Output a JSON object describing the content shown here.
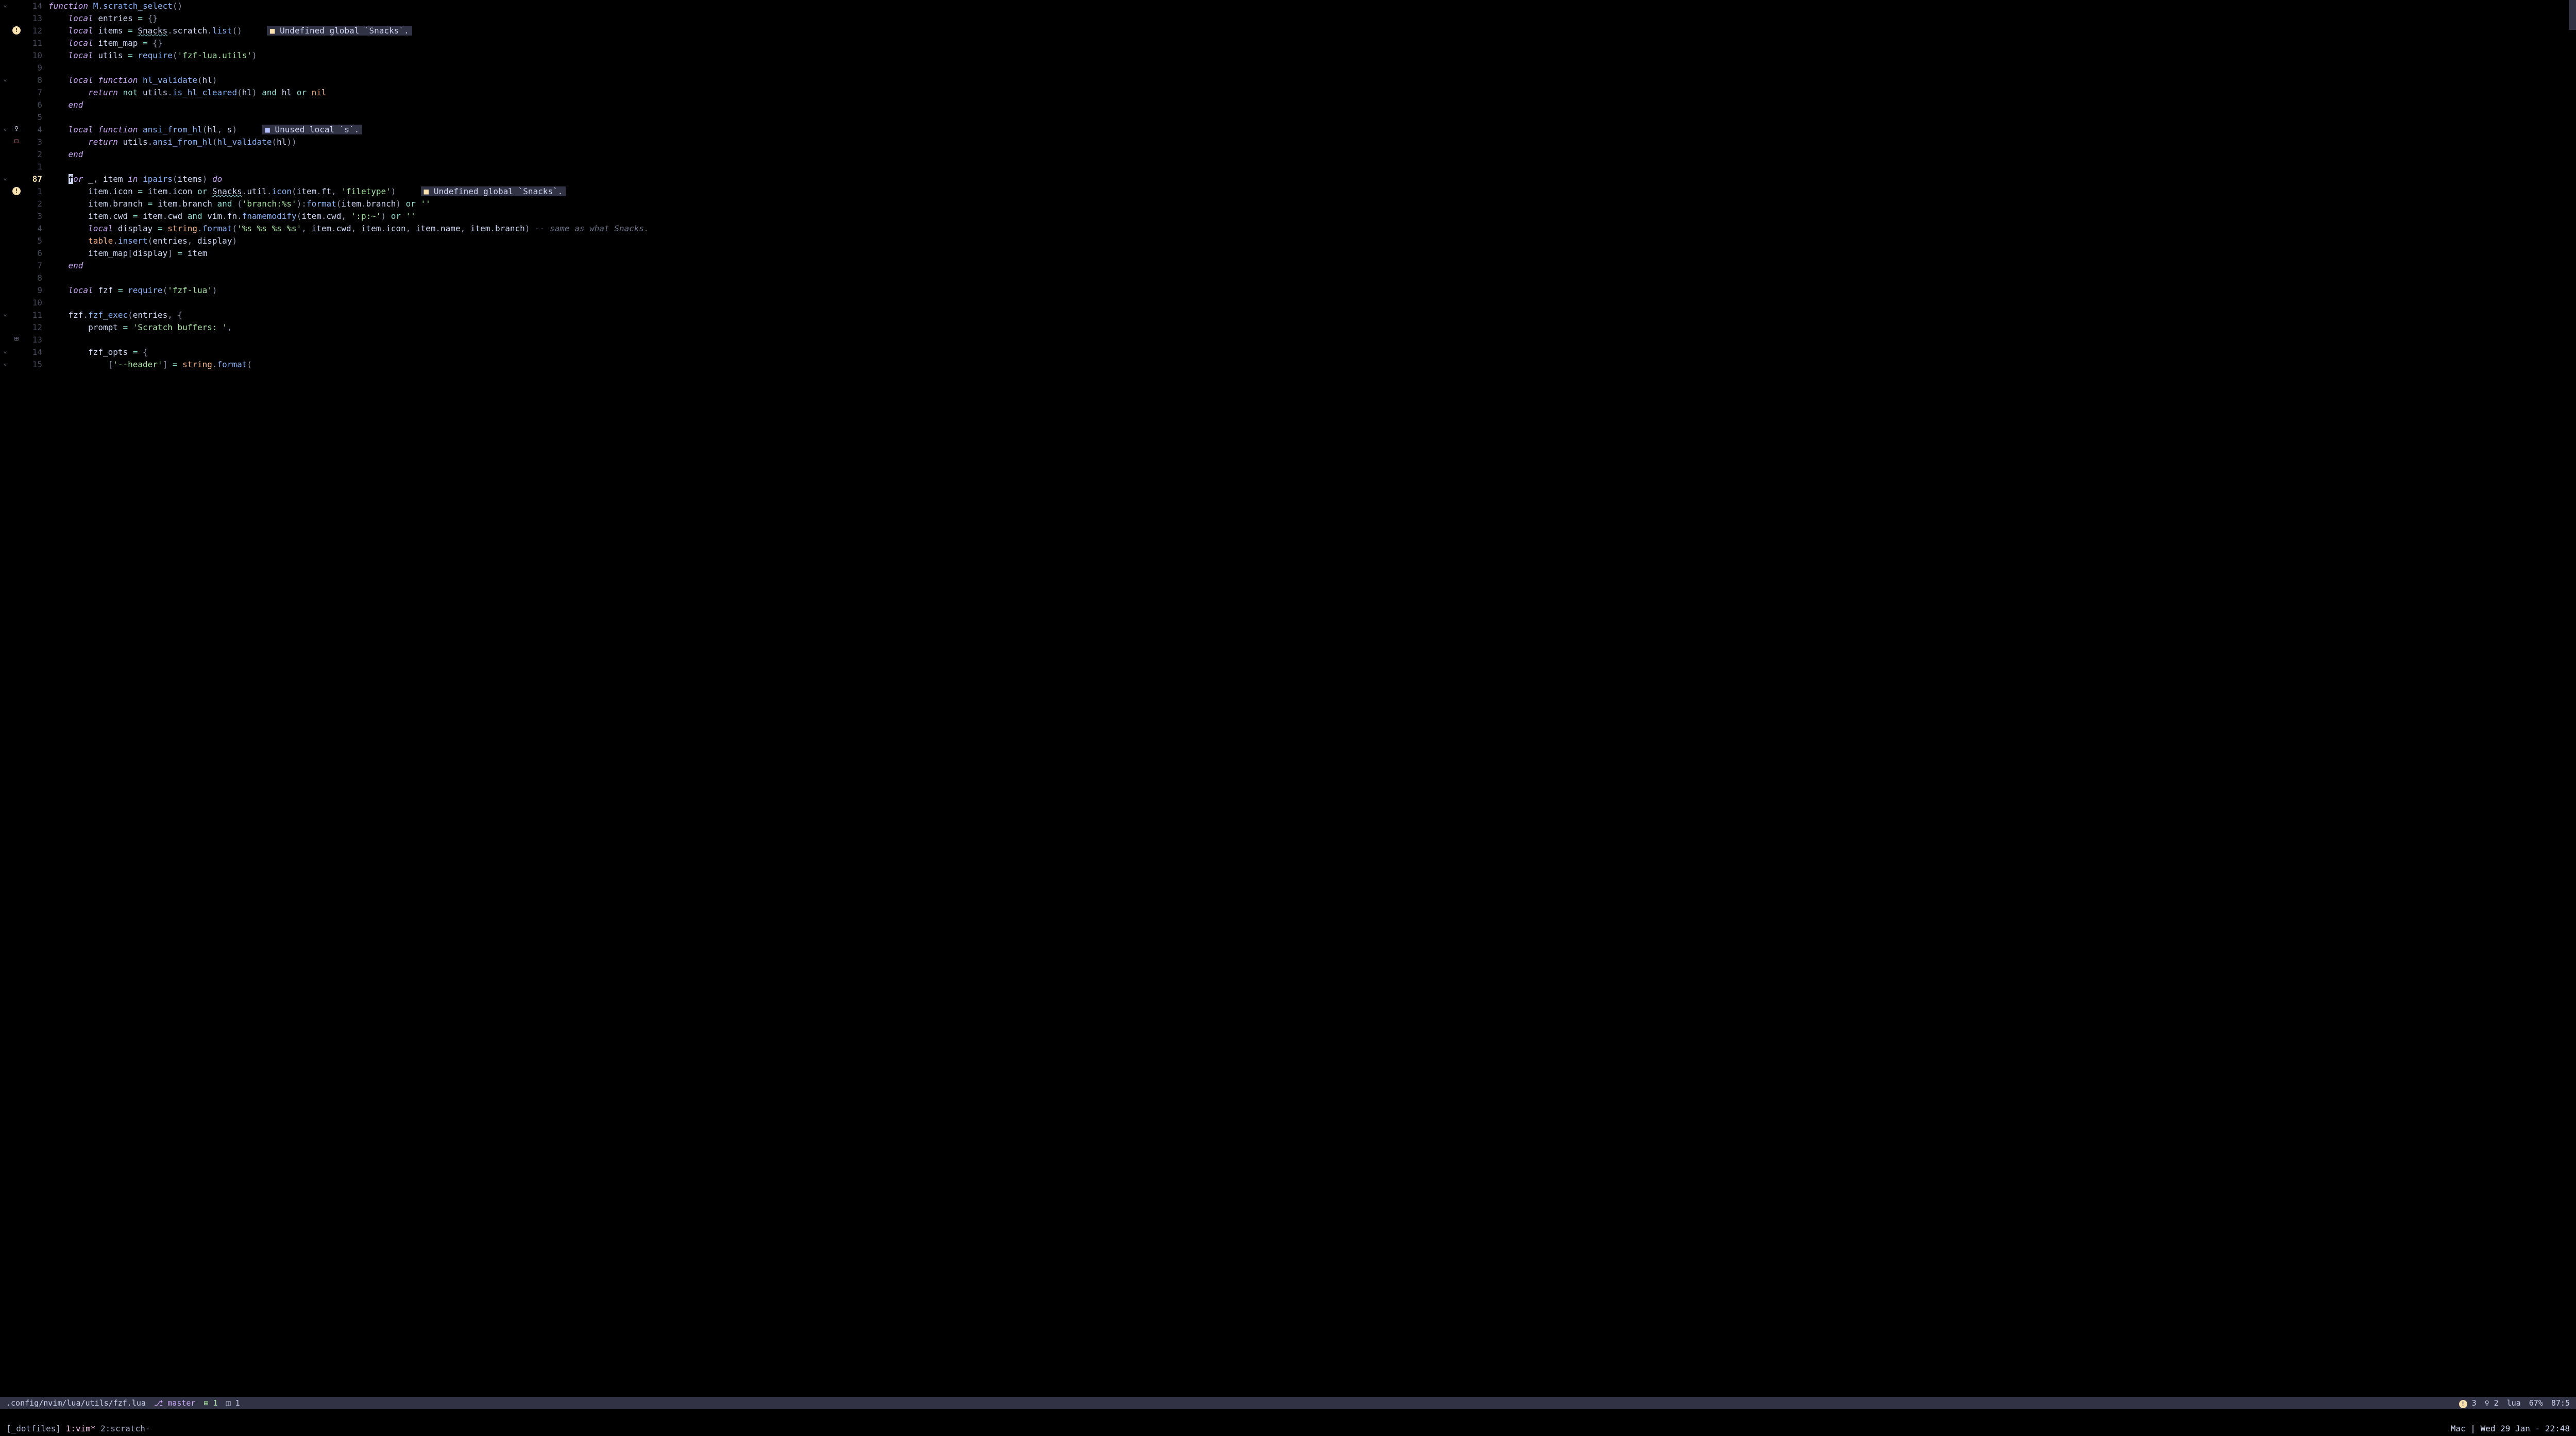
{
  "lines": [
    {
      "fold": "⌄",
      "sign": "",
      "ln": "14",
      "curr": false,
      "tokens": [
        {
          "t": "kw",
          "s": "function "
        },
        {
          "t": "fn",
          "s": "M"
        },
        {
          "t": "punc",
          "s": "."
        },
        {
          "t": "fn",
          "s": "scratch_select"
        },
        {
          "t": "punc",
          "s": "()"
        }
      ],
      "diag": null
    },
    {
      "fold": "",
      "sign": "",
      "ln": "13",
      "curr": false,
      "tokens": [
        {
          "t": "id",
          "s": "    "
        },
        {
          "t": "kw",
          "s": "local "
        },
        {
          "t": "id",
          "s": "entries "
        },
        {
          "t": "op",
          "s": "= "
        },
        {
          "t": "punc",
          "s": "{}"
        }
      ],
      "diag": null
    },
    {
      "fold": "",
      "sign": "warn",
      "ln": "12",
      "curr": false,
      "tokens": [
        {
          "t": "id",
          "s": "    "
        },
        {
          "t": "kw",
          "s": "local "
        },
        {
          "t": "id",
          "s": "items "
        },
        {
          "t": "op",
          "s": "= "
        },
        {
          "t": "und",
          "s": "Snacks"
        },
        {
          "t": "punc",
          "s": "."
        },
        {
          "t": "id",
          "s": "scratch"
        },
        {
          "t": "punc",
          "s": "."
        },
        {
          "t": "fn",
          "s": "list"
        },
        {
          "t": "punc",
          "s": "()"
        }
      ],
      "diag": {
        "type": "warn",
        "text": "Undefined global `Snacks`."
      }
    },
    {
      "fold": "",
      "sign": "",
      "ln": "11",
      "curr": false,
      "tokens": [
        {
          "t": "id",
          "s": "    "
        },
        {
          "t": "kw",
          "s": "local "
        },
        {
          "t": "id",
          "s": "item_map "
        },
        {
          "t": "op",
          "s": "= "
        },
        {
          "t": "punc",
          "s": "{}"
        }
      ],
      "diag": null
    },
    {
      "fold": "",
      "sign": "",
      "ln": "10",
      "curr": false,
      "tokens": [
        {
          "t": "id",
          "s": "    "
        },
        {
          "t": "kw",
          "s": "local "
        },
        {
          "t": "id",
          "s": "utils "
        },
        {
          "t": "op",
          "s": "= "
        },
        {
          "t": "fn",
          "s": "require"
        },
        {
          "t": "punc",
          "s": "("
        },
        {
          "t": "str",
          "s": "'fzf-lua.utils'"
        },
        {
          "t": "punc",
          "s": ")"
        }
      ],
      "diag": null
    },
    {
      "fold": "",
      "sign": "",
      "ln": "9",
      "curr": false,
      "tokens": [
        {
          "t": "id",
          "s": ""
        }
      ],
      "diag": null
    },
    {
      "fold": "⌄",
      "sign": "",
      "ln": "8",
      "curr": false,
      "tokens": [
        {
          "t": "id",
          "s": "    "
        },
        {
          "t": "kw",
          "s": "local function "
        },
        {
          "t": "fn",
          "s": "hl_validate"
        },
        {
          "t": "punc",
          "s": "("
        },
        {
          "t": "id",
          "s": "hl"
        },
        {
          "t": "punc",
          "s": ")"
        }
      ],
      "diag": null
    },
    {
      "fold": "",
      "sign": "",
      "ln": "7",
      "curr": false,
      "tokens": [
        {
          "t": "id",
          "s": "        "
        },
        {
          "t": "kw",
          "s": "return "
        },
        {
          "t": "op",
          "s": "not "
        },
        {
          "t": "id",
          "s": "utils"
        },
        {
          "t": "punc",
          "s": "."
        },
        {
          "t": "fn",
          "s": "is_hl_cleared"
        },
        {
          "t": "punc",
          "s": "("
        },
        {
          "t": "id",
          "s": "hl"
        },
        {
          "t": "punc",
          "s": ") "
        },
        {
          "t": "op",
          "s": "and "
        },
        {
          "t": "id",
          "s": "hl "
        },
        {
          "t": "op",
          "s": "or "
        },
        {
          "t": "ty",
          "s": "nil"
        }
      ],
      "diag": null
    },
    {
      "fold": "",
      "sign": "",
      "ln": "6",
      "curr": false,
      "tokens": [
        {
          "t": "id",
          "s": "    "
        },
        {
          "t": "kw",
          "s": "end"
        }
      ],
      "diag": null
    },
    {
      "fold": "",
      "sign": "",
      "ln": "5",
      "curr": false,
      "tokens": [
        {
          "t": "id",
          "s": ""
        }
      ],
      "diag": null
    },
    {
      "fold": "⌄",
      "sign": "hint",
      "ln": "4",
      "curr": false,
      "tokens": [
        {
          "t": "id",
          "s": "    "
        },
        {
          "t": "kw",
          "s": "local function "
        },
        {
          "t": "fn",
          "s": "ansi_from_hl"
        },
        {
          "t": "punc",
          "s": "("
        },
        {
          "t": "id",
          "s": "hl"
        },
        {
          "t": "punc",
          "s": ", "
        },
        {
          "t": "id",
          "s": "s"
        },
        {
          "t": "punc",
          "s": ")"
        }
      ],
      "diag": {
        "type": "hint",
        "text": "Unused local `s`."
      }
    },
    {
      "fold": "",
      "sign": "box",
      "ln": "3",
      "curr": false,
      "tokens": [
        {
          "t": "id",
          "s": "        "
        },
        {
          "t": "kw",
          "s": "return "
        },
        {
          "t": "id",
          "s": "utils"
        },
        {
          "t": "punc",
          "s": "."
        },
        {
          "t": "fn",
          "s": "ansi_from_hl"
        },
        {
          "t": "punc",
          "s": "("
        },
        {
          "t": "fn",
          "s": "hl_validate"
        },
        {
          "t": "punc",
          "s": "("
        },
        {
          "t": "id",
          "s": "hl"
        },
        {
          "t": "punc",
          "s": "))"
        }
      ],
      "diag": null
    },
    {
      "fold": "",
      "sign": "",
      "ln": "2",
      "curr": false,
      "tokens": [
        {
          "t": "id",
          "s": "    "
        },
        {
          "t": "kw",
          "s": "end"
        }
      ],
      "diag": null
    },
    {
      "fold": "",
      "sign": "",
      "ln": "1",
      "curr": false,
      "tokens": [
        {
          "t": "id",
          "s": ""
        }
      ],
      "diag": null
    },
    {
      "fold": "⌄",
      "sign": "",
      "ln": "87",
      "curr": true,
      "tokens": [
        {
          "t": "id",
          "s": "    "
        },
        {
          "t": "cursor",
          "s": "f"
        },
        {
          "t": "kw",
          "s": "or "
        },
        {
          "t": "id",
          "s": "_"
        },
        {
          "t": "punc",
          "s": ", "
        },
        {
          "t": "id",
          "s": "item "
        },
        {
          "t": "kw",
          "s": "in "
        },
        {
          "t": "fn",
          "s": "ipairs"
        },
        {
          "t": "punc",
          "s": "("
        },
        {
          "t": "id",
          "s": "items"
        },
        {
          "t": "punc",
          "s": ") "
        },
        {
          "t": "kw",
          "s": "do"
        }
      ],
      "diag": null
    },
    {
      "fold": "",
      "sign": "warn",
      "ln": "1",
      "curr": false,
      "tokens": [
        {
          "t": "id",
          "s": "        item"
        },
        {
          "t": "punc",
          "s": "."
        },
        {
          "t": "id",
          "s": "icon "
        },
        {
          "t": "op",
          "s": "= "
        },
        {
          "t": "id",
          "s": "item"
        },
        {
          "t": "punc",
          "s": "."
        },
        {
          "t": "id",
          "s": "icon "
        },
        {
          "t": "op",
          "s": "or "
        },
        {
          "t": "und",
          "s": "Snacks"
        },
        {
          "t": "punc",
          "s": "."
        },
        {
          "t": "id",
          "s": "util"
        },
        {
          "t": "punc",
          "s": "."
        },
        {
          "t": "fn",
          "s": "icon"
        },
        {
          "t": "punc",
          "s": "("
        },
        {
          "t": "id",
          "s": "item"
        },
        {
          "t": "punc",
          "s": "."
        },
        {
          "t": "id",
          "s": "ft"
        },
        {
          "t": "punc",
          "s": ", "
        },
        {
          "t": "str",
          "s": "'filetype'"
        },
        {
          "t": "punc",
          "s": ")"
        }
      ],
      "diag": {
        "type": "warn",
        "text": "Undefined global `Snacks`."
      }
    },
    {
      "fold": "",
      "sign": "",
      "ln": "2",
      "curr": false,
      "tokens": [
        {
          "t": "id",
          "s": "        item"
        },
        {
          "t": "punc",
          "s": "."
        },
        {
          "t": "id",
          "s": "branch "
        },
        {
          "t": "op",
          "s": "= "
        },
        {
          "t": "id",
          "s": "item"
        },
        {
          "t": "punc",
          "s": "."
        },
        {
          "t": "id",
          "s": "branch "
        },
        {
          "t": "op",
          "s": "and "
        },
        {
          "t": "punc",
          "s": "("
        },
        {
          "t": "str",
          "s": "'branch:%s'"
        },
        {
          "t": "punc",
          "s": "):"
        },
        {
          "t": "fn",
          "s": "format"
        },
        {
          "t": "punc",
          "s": "("
        },
        {
          "t": "id",
          "s": "item"
        },
        {
          "t": "punc",
          "s": "."
        },
        {
          "t": "id",
          "s": "branch"
        },
        {
          "t": "punc",
          "s": ") "
        },
        {
          "t": "op",
          "s": "or "
        },
        {
          "t": "str",
          "s": "''"
        }
      ],
      "diag": null
    },
    {
      "fold": "",
      "sign": "",
      "ln": "3",
      "curr": false,
      "tokens": [
        {
          "t": "id",
          "s": "        item"
        },
        {
          "t": "punc",
          "s": "."
        },
        {
          "t": "id",
          "s": "cwd "
        },
        {
          "t": "op",
          "s": "= "
        },
        {
          "t": "id",
          "s": "item"
        },
        {
          "t": "punc",
          "s": "."
        },
        {
          "t": "id",
          "s": "cwd "
        },
        {
          "t": "op",
          "s": "and "
        },
        {
          "t": "id",
          "s": "vim"
        },
        {
          "t": "punc",
          "s": "."
        },
        {
          "t": "id",
          "s": "fn"
        },
        {
          "t": "punc",
          "s": "."
        },
        {
          "t": "fn",
          "s": "fnamemodify"
        },
        {
          "t": "punc",
          "s": "("
        },
        {
          "t": "id",
          "s": "item"
        },
        {
          "t": "punc",
          "s": "."
        },
        {
          "t": "id",
          "s": "cwd"
        },
        {
          "t": "punc",
          "s": ", "
        },
        {
          "t": "str",
          "s": "':p:~'"
        },
        {
          "t": "punc",
          "s": ") "
        },
        {
          "t": "op",
          "s": "or "
        },
        {
          "t": "str",
          "s": "''"
        }
      ],
      "diag": null
    },
    {
      "fold": "",
      "sign": "",
      "ln": "4",
      "curr": false,
      "tokens": [
        {
          "t": "id",
          "s": "        "
        },
        {
          "t": "kw",
          "s": "local "
        },
        {
          "t": "id",
          "s": "display "
        },
        {
          "t": "op",
          "s": "= "
        },
        {
          "t": "ty",
          "s": "string"
        },
        {
          "t": "punc",
          "s": "."
        },
        {
          "t": "fn",
          "s": "format"
        },
        {
          "t": "punc",
          "s": "("
        },
        {
          "t": "str",
          "s": "'%s %s %s %s'"
        },
        {
          "t": "punc",
          "s": ", "
        },
        {
          "t": "id",
          "s": "item"
        },
        {
          "t": "punc",
          "s": "."
        },
        {
          "t": "id",
          "s": "cwd"
        },
        {
          "t": "punc",
          "s": ", "
        },
        {
          "t": "id",
          "s": "item"
        },
        {
          "t": "punc",
          "s": "."
        },
        {
          "t": "id",
          "s": "icon"
        },
        {
          "t": "punc",
          "s": ", "
        },
        {
          "t": "id",
          "s": "item"
        },
        {
          "t": "punc",
          "s": "."
        },
        {
          "t": "id",
          "s": "name"
        },
        {
          "t": "punc",
          "s": ", "
        },
        {
          "t": "id",
          "s": "item"
        },
        {
          "t": "punc",
          "s": "."
        },
        {
          "t": "id",
          "s": "branch"
        },
        {
          "t": "punc",
          "s": ") "
        },
        {
          "t": "cmt",
          "s": "-- same as what Snacks."
        }
      ],
      "diag": null
    },
    {
      "fold": "",
      "sign": "",
      "ln": "5",
      "curr": false,
      "tokens": [
        {
          "t": "id",
          "s": "        "
        },
        {
          "t": "ty",
          "s": "table"
        },
        {
          "t": "punc",
          "s": "."
        },
        {
          "t": "fn",
          "s": "insert"
        },
        {
          "t": "punc",
          "s": "("
        },
        {
          "t": "id",
          "s": "entries"
        },
        {
          "t": "punc",
          "s": ", "
        },
        {
          "t": "id",
          "s": "display"
        },
        {
          "t": "punc",
          "s": ")"
        }
      ],
      "diag": null
    },
    {
      "fold": "",
      "sign": "",
      "ln": "6",
      "curr": false,
      "tokens": [
        {
          "t": "id",
          "s": "        item_map"
        },
        {
          "t": "punc",
          "s": "["
        },
        {
          "t": "id",
          "s": "display"
        },
        {
          "t": "punc",
          "s": "] "
        },
        {
          "t": "op",
          "s": "= "
        },
        {
          "t": "id",
          "s": "item"
        }
      ],
      "diag": null
    },
    {
      "fold": "",
      "sign": "",
      "ln": "7",
      "curr": false,
      "tokens": [
        {
          "t": "id",
          "s": "    "
        },
        {
          "t": "kw",
          "s": "end"
        }
      ],
      "diag": null
    },
    {
      "fold": "",
      "sign": "",
      "ln": "8",
      "curr": false,
      "tokens": [
        {
          "t": "id",
          "s": ""
        }
      ],
      "diag": null
    },
    {
      "fold": "",
      "sign": "",
      "ln": "9",
      "curr": false,
      "tokens": [
        {
          "t": "id",
          "s": "    "
        },
        {
          "t": "kw",
          "s": "local "
        },
        {
          "t": "id",
          "s": "fzf "
        },
        {
          "t": "op",
          "s": "= "
        },
        {
          "t": "fn",
          "s": "require"
        },
        {
          "t": "punc",
          "s": "("
        },
        {
          "t": "str",
          "s": "'fzf-lua'"
        },
        {
          "t": "punc",
          "s": ")"
        }
      ],
      "diag": null
    },
    {
      "fold": "",
      "sign": "",
      "ln": "10",
      "curr": false,
      "tokens": [
        {
          "t": "id",
          "s": ""
        }
      ],
      "diag": null
    },
    {
      "fold": "⌄",
      "sign": "",
      "ln": "11",
      "curr": false,
      "tokens": [
        {
          "t": "id",
          "s": "    fzf"
        },
        {
          "t": "punc",
          "s": "."
        },
        {
          "t": "fn",
          "s": "fzf_exec"
        },
        {
          "t": "punc",
          "s": "("
        },
        {
          "t": "id",
          "s": "entries"
        },
        {
          "t": "punc",
          "s": ", {"
        }
      ],
      "diag": null
    },
    {
      "fold": "",
      "sign": "",
      "ln": "12",
      "curr": false,
      "tokens": [
        {
          "t": "id",
          "s": "        prompt "
        },
        {
          "t": "op",
          "s": "= "
        },
        {
          "t": "str",
          "s": "'Scratch buffers: '"
        },
        {
          "t": "punc",
          "s": ","
        }
      ],
      "diag": null
    },
    {
      "fold": "",
      "sign": "plus",
      "ln": "13",
      "curr": false,
      "tokens": [
        {
          "t": "id",
          "s": ""
        }
      ],
      "diag": null
    },
    {
      "fold": "⌄",
      "sign": "",
      "ln": "14",
      "curr": false,
      "tokens": [
        {
          "t": "id",
          "s": "        fzf_opts "
        },
        {
          "t": "op",
          "s": "= "
        },
        {
          "t": "punc",
          "s": "{"
        }
      ],
      "diag": null
    },
    {
      "fold": "⌄",
      "sign": "",
      "ln": "15",
      "curr": false,
      "tokens": [
        {
          "t": "id",
          "s": "            "
        },
        {
          "t": "punc",
          "s": "["
        },
        {
          "t": "str",
          "s": "'--header'"
        },
        {
          "t": "punc",
          "s": "] "
        },
        {
          "t": "op",
          "s": "= "
        },
        {
          "t": "ty",
          "s": "string"
        },
        {
          "t": "punc",
          "s": "."
        },
        {
          "t": "fn",
          "s": "format"
        },
        {
          "t": "punc",
          "s": "("
        }
      ],
      "diag": null
    }
  ],
  "statusline": {
    "path": ".config/nvim/lua/utils/fzf.lua",
    "branch_icon": "⎇",
    "branch": "master",
    "git_add_icon": "⊞",
    "git_add": "1",
    "git_change_icon": "◫",
    "git_change": "1",
    "warn_count": "3",
    "hint_count": "2",
    "filetype": "lua",
    "percent": "67%",
    "pos": "87:5"
  },
  "tmux": {
    "session": "[_dotfiles]",
    "win1": "1:vim*",
    "win2": "2:scratch-",
    "host": "Mac",
    "sep": "|",
    "date": "Wed 29 Jan",
    "dash": "-",
    "time": "22:48"
  }
}
